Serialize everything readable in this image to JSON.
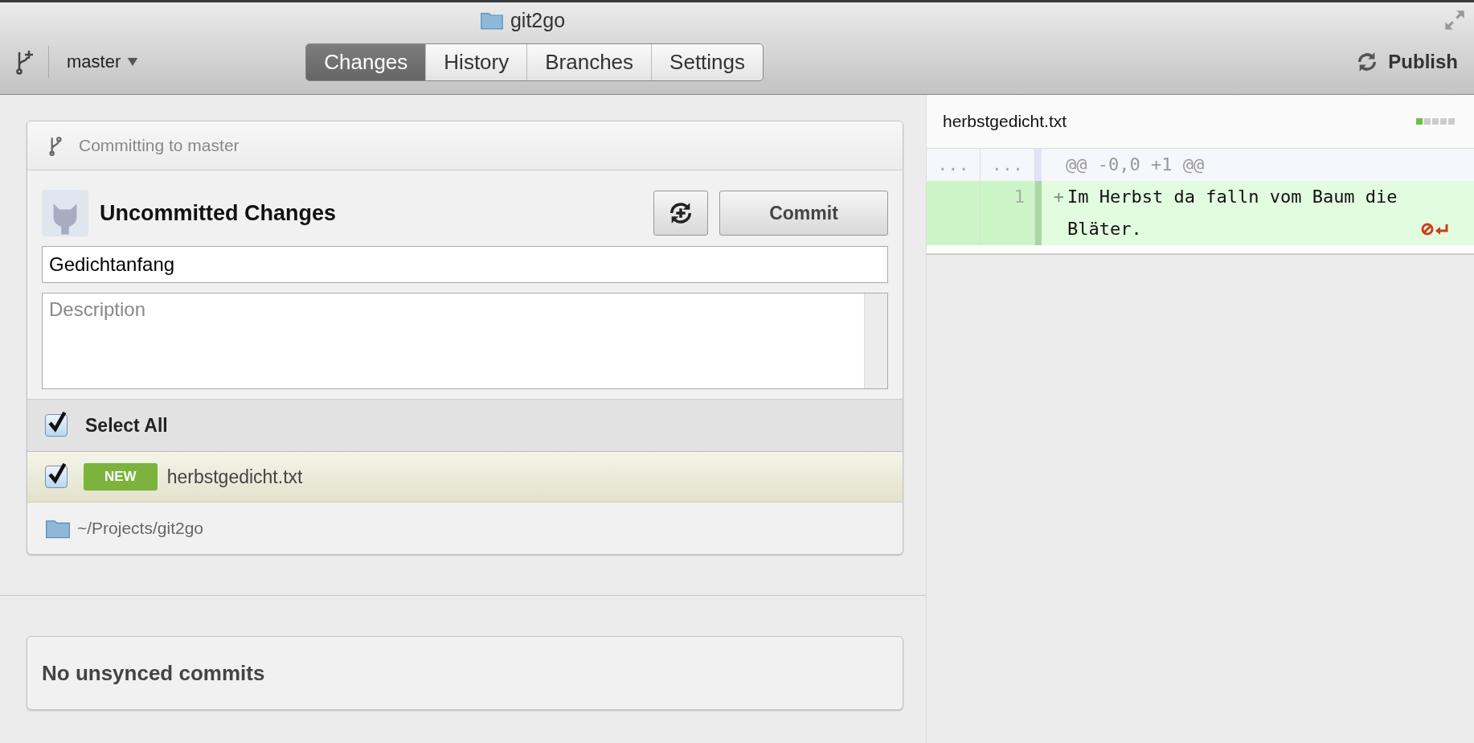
{
  "window": {
    "title": "git2go"
  },
  "toolbar": {
    "branch": "master",
    "tabs": [
      {
        "label": "Changes",
        "selected": true
      },
      {
        "label": "History",
        "selected": false
      },
      {
        "label": "Branches",
        "selected": false
      },
      {
        "label": "Settings",
        "selected": false
      }
    ],
    "publish": "Publish"
  },
  "commit_panel": {
    "header": "Committing to master",
    "title": "Uncommitted Changes",
    "commit_button": "Commit",
    "summary": {
      "value": "Gedichtanfang"
    },
    "description": {
      "placeholder": "Description"
    },
    "select_all": {
      "label": "Select All",
      "checked": true
    },
    "files": [
      {
        "name": "herbstgedicht.txt",
        "badge": "NEW",
        "checked": true,
        "selected": true
      }
    ],
    "repo_path": "~/Projects/git2go"
  },
  "sync_panel": {
    "message": "No unsynced commits"
  },
  "diff": {
    "file": "herbstgedicht.txt",
    "lines": [
      {
        "kind": "hunk",
        "old": "...",
        "new": "...",
        "text": "@@ -0,0 +1 @@"
      },
      {
        "kind": "added",
        "new": "1",
        "sign": "+",
        "text": "Im Herbst da falln vom Baum die Bläter.",
        "no_newline": true
      }
    ]
  }
}
